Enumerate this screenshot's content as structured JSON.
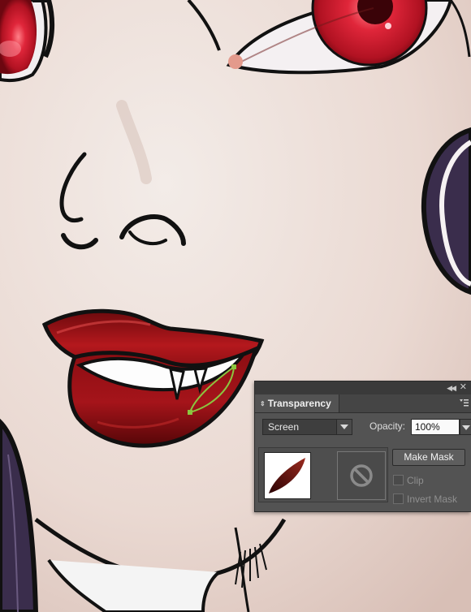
{
  "panel": {
    "title": "Transparency",
    "blend_mode": "Screen",
    "opacity_label": "Opacity:",
    "opacity_value": "100%",
    "make_mask_label": "Make Mask",
    "clip_label": "Clip",
    "invert_mask_label": "Invert Mask",
    "clip_checked": false,
    "invert_mask_checked": false
  },
  "colors": {
    "skin": "#e9ded8",
    "lip_dark": "#7a0c0e",
    "lip_red": "#b0161b",
    "iris_red": "#d01f2c",
    "hair_purple": "#3a2d4c",
    "outline": "#111111",
    "selection_green": "#8bc53f",
    "panel_bg": "#535353"
  }
}
